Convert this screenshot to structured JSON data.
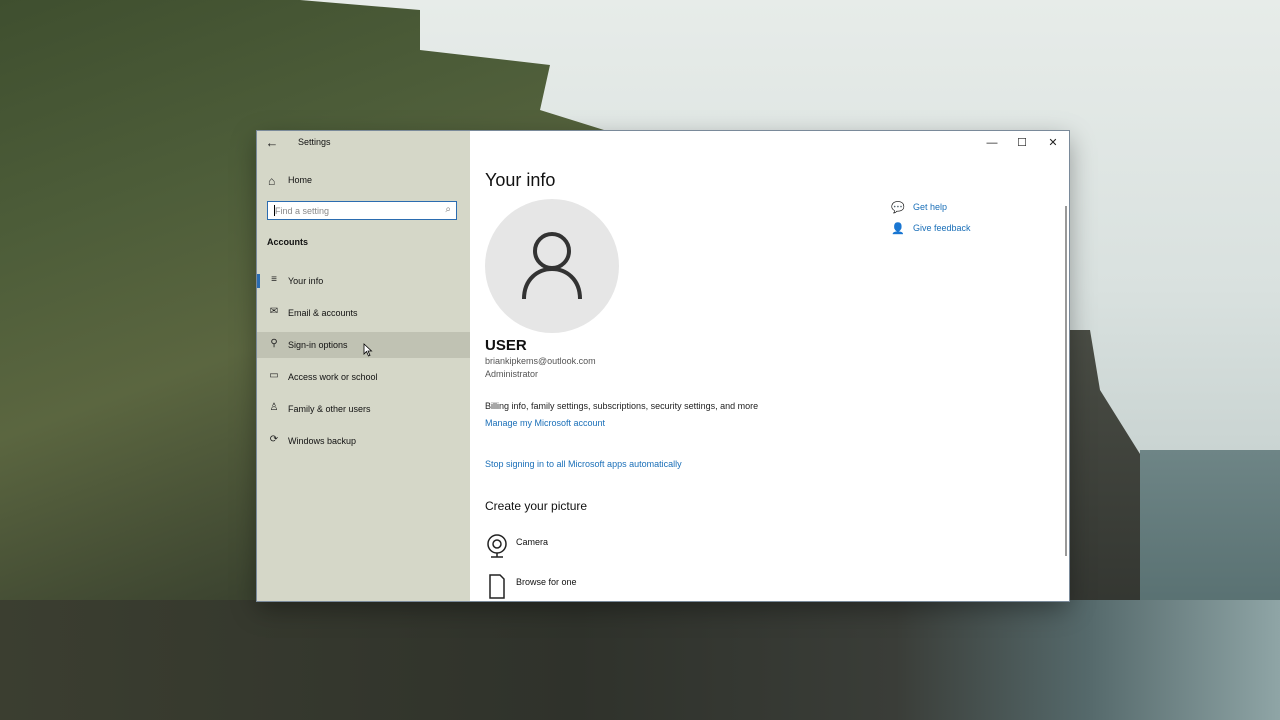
{
  "window": {
    "title": "Settings",
    "controls": {
      "minimize": "—",
      "maximize": "☐",
      "close": "✕"
    }
  },
  "sidebar": {
    "home_label": "Home",
    "search_placeholder": "Find a setting",
    "section_title": "Accounts",
    "items": [
      {
        "label": "Your info",
        "icon": "person-card-icon",
        "selected": true
      },
      {
        "label": "Email & accounts",
        "icon": "mail-icon"
      },
      {
        "label": "Sign-in options",
        "icon": "key-icon",
        "hover": true
      },
      {
        "label": "Access work or school",
        "icon": "briefcase-icon"
      },
      {
        "label": "Family & other users",
        "icon": "person-icon"
      },
      {
        "label": "Windows backup",
        "icon": "sync-icon"
      }
    ]
  },
  "main": {
    "page_title": "Your info",
    "user": {
      "name": "USER",
      "email": "briankipkems@outlook.com",
      "role": "Administrator"
    },
    "billing_text": "Billing info, family settings, subscriptions, security settings, and more",
    "manage_link": "Manage my Microsoft account",
    "stop_link": "Stop signing in to all Microsoft apps automatically",
    "create_picture_title": "Create your picture",
    "picture_options": [
      {
        "label": "Camera",
        "icon": "camera-icon"
      },
      {
        "label": "Browse for one",
        "icon": "file-icon"
      }
    ],
    "help": [
      {
        "label": "Get help",
        "icon": "chat-help-icon"
      },
      {
        "label": "Give feedback",
        "icon": "feedback-icon"
      }
    ]
  },
  "colors": {
    "accent": "#1a6fb8",
    "selection_bar": "#2b6cb0"
  }
}
